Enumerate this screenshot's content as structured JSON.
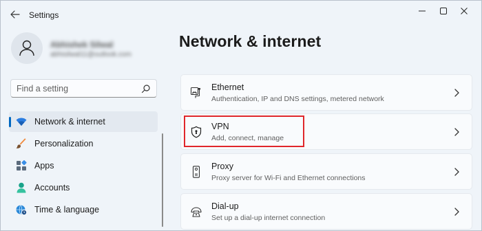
{
  "window": {
    "title": "Settings"
  },
  "profile": {
    "name": "Abhishek Silwal",
    "email": "abhisilwal11@outlook.com"
  },
  "search": {
    "placeholder": "Find a setting"
  },
  "sidebar": {
    "items": [
      {
        "label": "Network & internet",
        "icon": "wifi-icon",
        "active": true
      },
      {
        "label": "Personalization",
        "icon": "brush-icon",
        "active": false
      },
      {
        "label": "Apps",
        "icon": "apps-icon",
        "active": false
      },
      {
        "label": "Accounts",
        "icon": "accounts-icon",
        "active": false
      },
      {
        "label": "Time & language",
        "icon": "globe-clock-icon",
        "active": false
      }
    ]
  },
  "main": {
    "title": "Network & internet",
    "cards": [
      {
        "title": "Ethernet",
        "description": "Authentication, IP and DNS settings, metered network",
        "icon": "ethernet-icon"
      },
      {
        "title": "VPN",
        "description": "Add, connect, manage",
        "icon": "shield-icon",
        "highlighted": true
      },
      {
        "title": "Proxy",
        "description": "Proxy server for Wi-Fi and Ethernet connections",
        "icon": "proxy-icon"
      },
      {
        "title": "Dial-up",
        "description": "Set up a dial-up internet connection",
        "icon": "dialup-icon"
      }
    ]
  },
  "colors": {
    "accent": "#0067c0",
    "highlight": "#e0262a",
    "background": "#eff4f9"
  }
}
